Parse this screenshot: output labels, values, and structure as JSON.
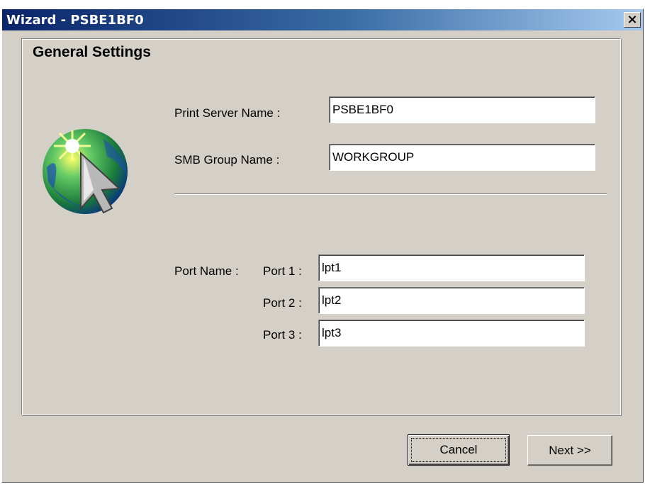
{
  "window": {
    "title": "Wizard - PSBE1BF0",
    "close_glyph": "×"
  },
  "panel": {
    "title": "General Settings"
  },
  "form": {
    "print_server_name_label": "Print Server Name :",
    "print_server_name_value": "PSBE1BF0",
    "smb_group_name_label": "SMB Group Name :",
    "smb_group_name_value": "WORKGROUP",
    "port_name_label": "Port Name :",
    "ports": [
      {
        "label": "Port 1 :",
        "value": "lpt1"
      },
      {
        "label": "Port 2 :",
        "value": "lpt2"
      },
      {
        "label": "Port 3 :",
        "value": "lpt3"
      }
    ]
  },
  "buttons": {
    "cancel": "Cancel",
    "next": "Next >>"
  },
  "icons": {
    "wizard": "globe-cursor-icon",
    "close": "close-icon"
  },
  "colors": {
    "titlebar_start": "#0a246a",
    "titlebar_end": "#a6caf0",
    "face": "#d4d0c8"
  }
}
